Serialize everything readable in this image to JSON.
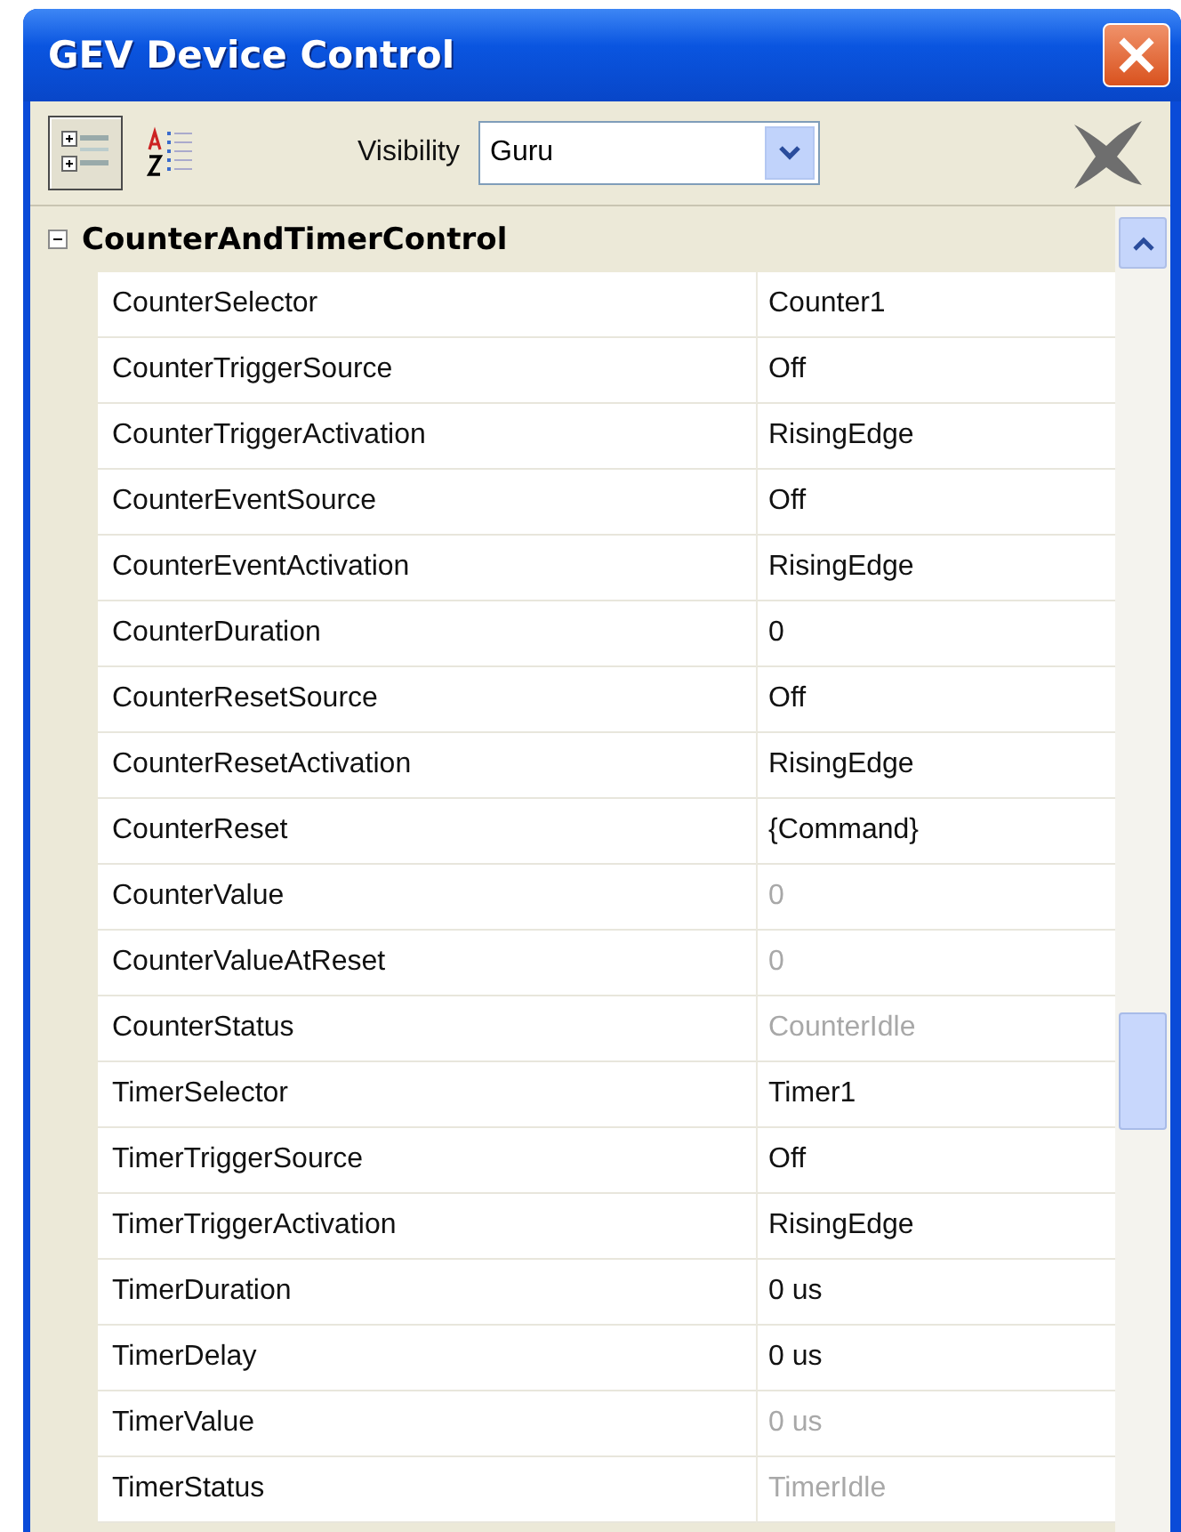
{
  "window": {
    "title": "GEV Device Control"
  },
  "toolbar": {
    "view_buttons": [
      {
        "kind": "categorized",
        "selected": true
      },
      {
        "kind": "alphabetical",
        "selected": false
      }
    ],
    "visibility_label": "Visibility",
    "visibility_value": "Guru"
  },
  "section": {
    "title": "CounterAndTimerControl",
    "expanded": true,
    "rows": [
      {
        "name": "CounterSelector",
        "value": "Counter1",
        "readonly": false
      },
      {
        "name": "CounterTriggerSource",
        "value": "Off",
        "readonly": false
      },
      {
        "name": "CounterTriggerActivation",
        "value": "RisingEdge",
        "readonly": false
      },
      {
        "name": "CounterEventSource",
        "value": "Off",
        "readonly": false
      },
      {
        "name": "CounterEventActivation",
        "value": "RisingEdge",
        "readonly": false
      },
      {
        "name": "CounterDuration",
        "value": "0",
        "readonly": false
      },
      {
        "name": "CounterResetSource",
        "value": "Off",
        "readonly": false
      },
      {
        "name": "CounterResetActivation",
        "value": "RisingEdge",
        "readonly": false
      },
      {
        "name": "CounterReset",
        "value": "{Command}",
        "readonly": false
      },
      {
        "name": "CounterValue",
        "value": "0",
        "readonly": true
      },
      {
        "name": "CounterValueAtReset",
        "value": "0",
        "readonly": true
      },
      {
        "name": "CounterStatus",
        "value": "CounterIdle",
        "readonly": true
      },
      {
        "name": "TimerSelector",
        "value": "Timer1",
        "readonly": false
      },
      {
        "name": "TimerTriggerSource",
        "value": "Off",
        "readonly": false
      },
      {
        "name": "TimerTriggerActivation",
        "value": "RisingEdge",
        "readonly": false
      },
      {
        "name": "TimerDuration",
        "value": "0 us",
        "readonly": false
      },
      {
        "name": "TimerDelay",
        "value": "0 us",
        "readonly": false
      },
      {
        "name": "TimerValue",
        "value": "0 us",
        "readonly": true
      },
      {
        "name": "TimerStatus",
        "value": "TimerIdle",
        "readonly": true
      }
    ]
  }
}
